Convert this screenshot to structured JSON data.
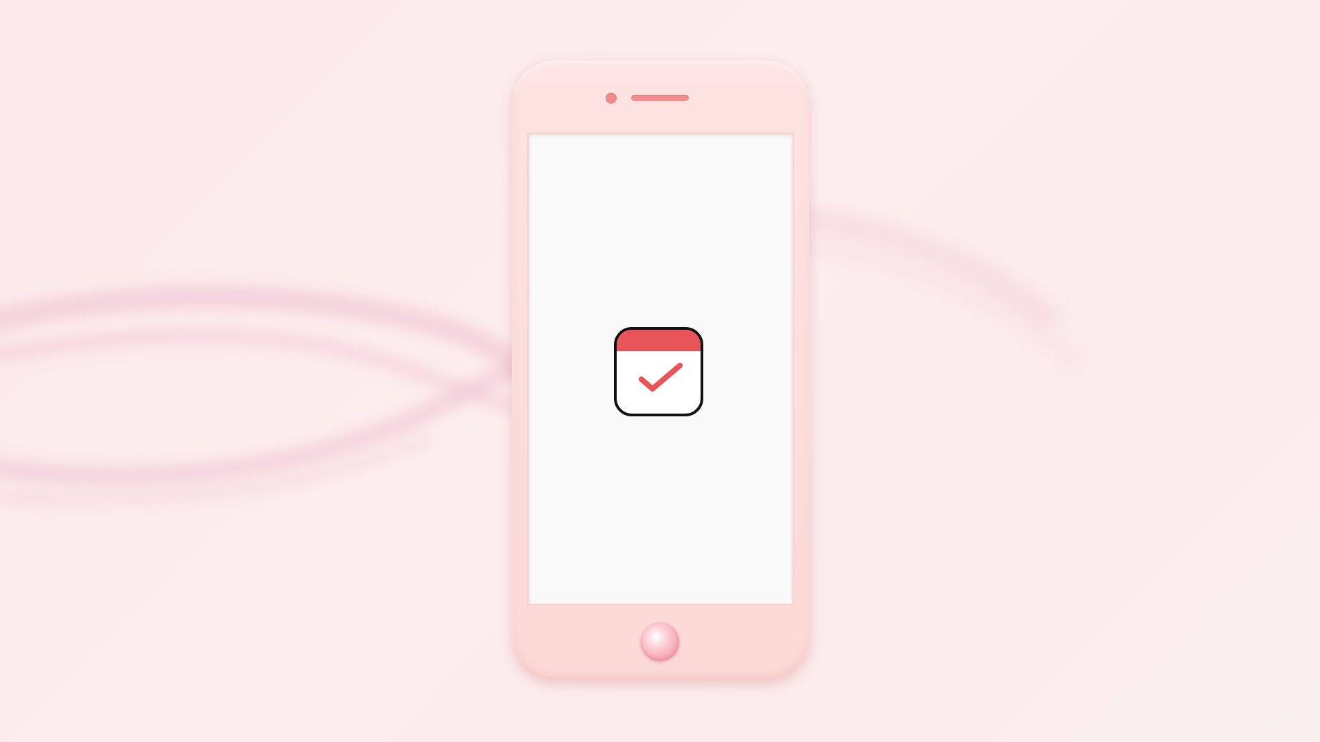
{
  "colors": {
    "background": "#fbeaea",
    "phone_body": "#fbdcd9",
    "screen": "#f9f9f9",
    "accent_red": "#e85458",
    "speaker": "#f58f92",
    "swoosh": "#efc4d2"
  },
  "icons": {
    "app": "calendar-check-icon",
    "camera": "camera-icon",
    "speaker": "speaker-icon",
    "home": "home-button"
  }
}
